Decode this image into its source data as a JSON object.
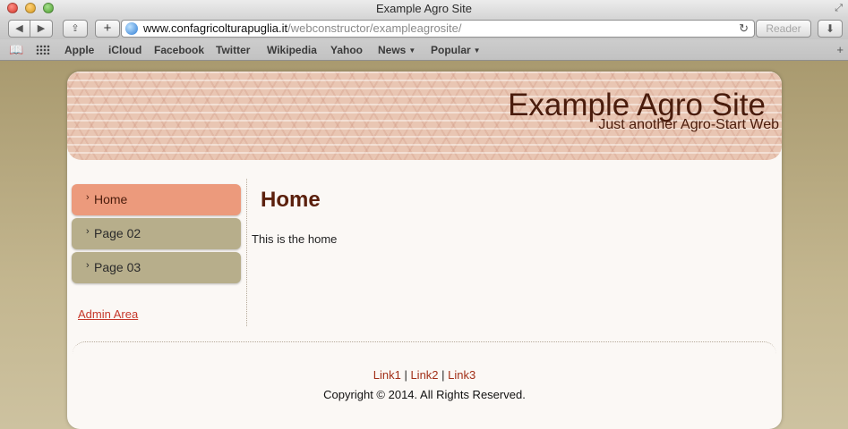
{
  "window": {
    "title": "Example Agro Site"
  },
  "toolbar": {
    "back_label": "◀",
    "forward_label": "▶",
    "share_label": "⇪",
    "add_label": "+",
    "url_host": "www.confagricolturapuglia.it",
    "url_path": "/webconstructor/exampleagrosite/",
    "reload_label": "↻",
    "reader_label": "Reader",
    "download_label": "⬇"
  },
  "bookmarks": {
    "items": [
      "Apple",
      "iCloud",
      "Facebook",
      "Twitter",
      "Wikipedia",
      "Yahoo",
      "News",
      "Popular"
    ],
    "dropdown_caret": "▼",
    "add_label": "+"
  },
  "site": {
    "title": "Example Agro Site",
    "tagline": "Just another Agro-Start Web"
  },
  "nav": {
    "chevron": "›",
    "items": [
      {
        "label": "Home",
        "active": true
      },
      {
        "label": "Page 02",
        "active": false
      },
      {
        "label": "Page 03",
        "active": false
      }
    ],
    "admin_link": "Admin Area"
  },
  "content": {
    "heading": "Home",
    "body": "This is the home"
  },
  "footer": {
    "links": [
      "Link1",
      "Link2",
      "Link3"
    ],
    "separator": " | ",
    "copyright": "Copyright © 2014. All Rights Reserved."
  },
  "colors": {
    "nav_active": "#ec9a7c",
    "nav_inactive": "#b7ae8b",
    "link_red": "#c6382b",
    "title_brown": "#4a1c0c"
  }
}
